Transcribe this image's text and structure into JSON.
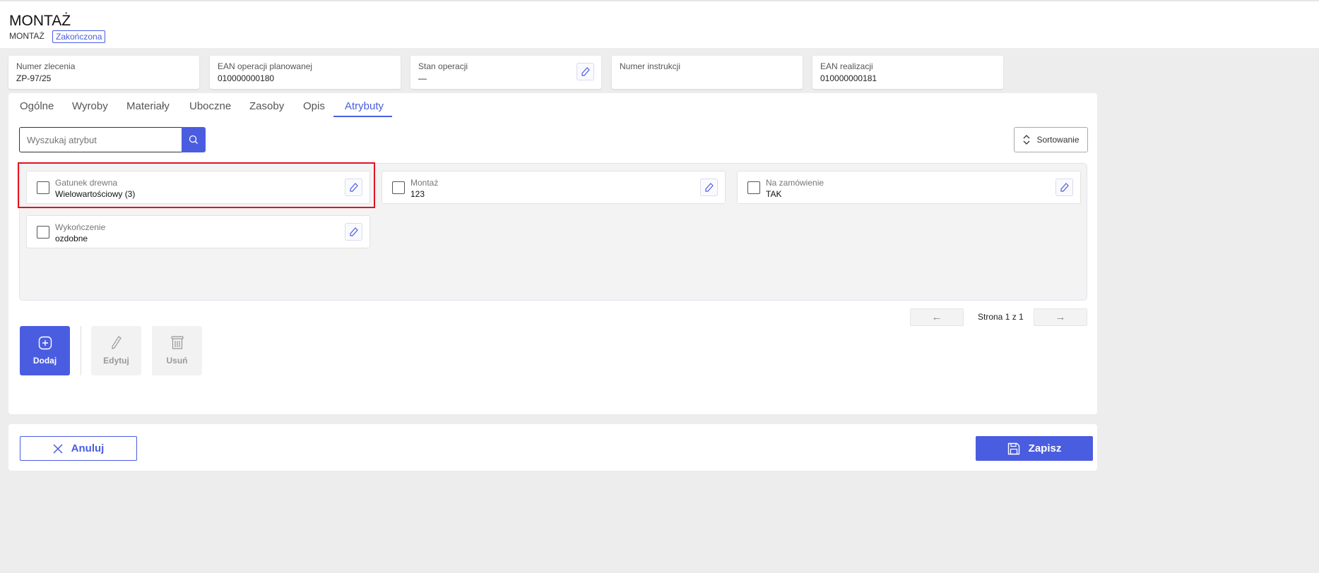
{
  "header": {
    "title": "MONTAŻ",
    "subtitle": "MONTAŻ",
    "status": "Zakończona"
  },
  "info": [
    {
      "label": "Numer zlecenia",
      "value": "ZP-97/25"
    },
    {
      "label": "EAN operacji planowanej",
      "value": "010000000180"
    },
    {
      "label": "Stan operacji",
      "value": "—"
    },
    {
      "label": "Numer instrukcji",
      "value": ""
    },
    {
      "label": "EAN realizacji",
      "value": "010000000181"
    }
  ],
  "tabs": [
    "Ogólne",
    "Wyroby",
    "Materiały",
    "Uboczne",
    "Zasoby",
    "Opis",
    "Atrybuty"
  ],
  "active_tab": "Atrybuty",
  "search": {
    "placeholder": "Wyszukaj atrybut"
  },
  "sort_label": "Sortowanie",
  "attributes": [
    {
      "label": "Gatunek drewna",
      "value": "Wielowartościowy (3)"
    },
    {
      "label": "Montaż",
      "value": "123"
    },
    {
      "label": "Na zamówienie",
      "value": "TAK"
    },
    {
      "label": "Wykończenie",
      "value": "ozdobne"
    }
  ],
  "pagination": {
    "text": "Strona 1 z 1",
    "prev": "←",
    "next": "→"
  },
  "actions": {
    "add": "Dodaj",
    "edit": "Edytuj",
    "delete": "Usuń"
  },
  "footer": {
    "cancel": "Anuluj",
    "save": "Zapisz"
  },
  "colors": {
    "accent": "#4a5de0",
    "highlight": "#e3121f"
  }
}
